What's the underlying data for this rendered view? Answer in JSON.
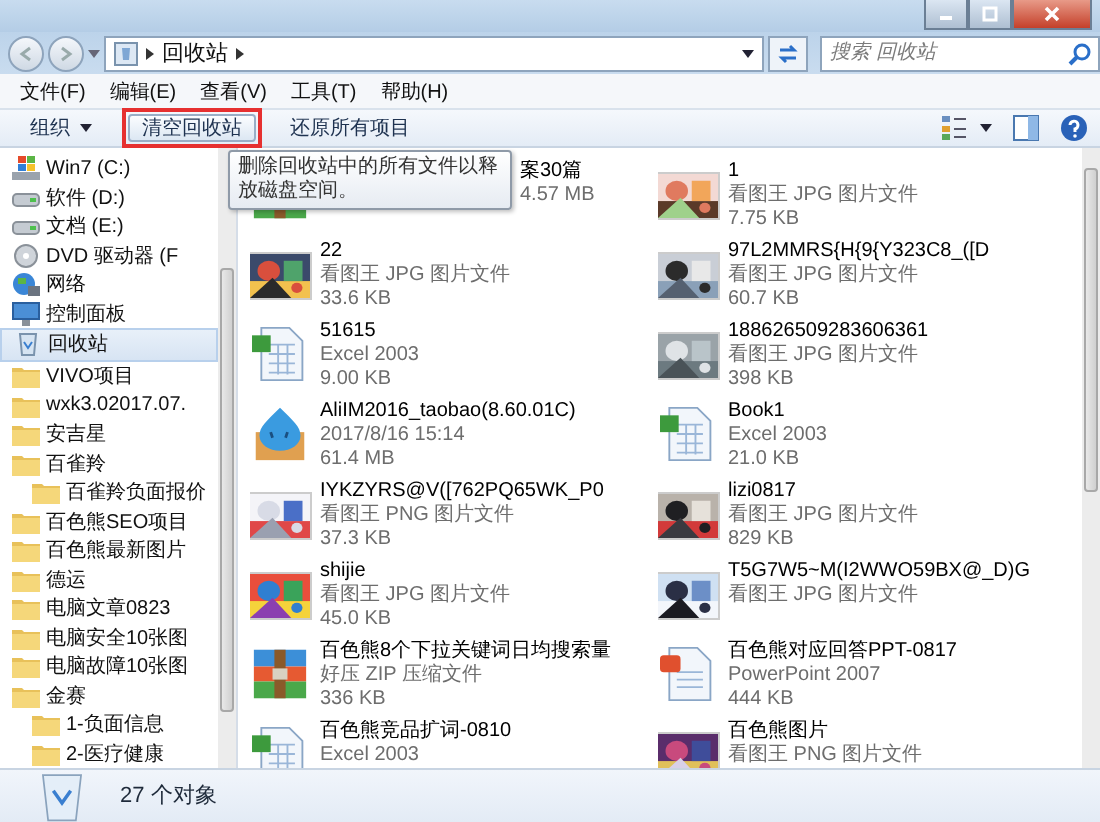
{
  "address": {
    "path": [
      "回收站"
    ]
  },
  "search": {
    "placeholder": "搜索 回收站"
  },
  "menu": [
    "文件(F)",
    "编辑(E)",
    "查看(V)",
    "工具(T)",
    "帮助(H)"
  ],
  "toolbar": {
    "organize": "组织",
    "buttons": [
      {
        "label": "清空回收站",
        "hovered": true,
        "annotated": true
      },
      {
        "label": "还原所有项目",
        "hovered": false,
        "annotated": false
      }
    ]
  },
  "tooltip": "删除回收站中的所有文件以释放磁盘空间。",
  "nav": [
    {
      "label": "Win7 (C:)",
      "kind": "system-drive",
      "selected": false
    },
    {
      "label": "软件 (D:)",
      "kind": "drive",
      "selected": false
    },
    {
      "label": "文档 (E:)",
      "kind": "drive",
      "selected": false
    },
    {
      "label": "DVD 驱动器 (F",
      "kind": "dvd",
      "selected": false
    },
    {
      "label": "网络",
      "kind": "network",
      "selected": false
    },
    {
      "label": "控制面板",
      "kind": "control-panel",
      "selected": false
    },
    {
      "label": "回收站",
      "kind": "recycle",
      "selected": true
    },
    {
      "label": "VIVO项目",
      "kind": "folder",
      "selected": false
    },
    {
      "label": "wxk3.02017.07.",
      "kind": "folder",
      "selected": false
    },
    {
      "label": "安吉星",
      "kind": "folder",
      "selected": false
    },
    {
      "label": "百雀羚",
      "kind": "folder",
      "selected": false,
      "children": [
        {
          "label": "百雀羚负面报价",
          "kind": "folder",
          "selected": false
        }
      ]
    },
    {
      "label": "百色熊SEO项目",
      "kind": "folder",
      "selected": false
    },
    {
      "label": "百色熊最新图片",
      "kind": "folder",
      "selected": false
    },
    {
      "label": "德运",
      "kind": "folder",
      "selected": false
    },
    {
      "label": "电脑文章0823",
      "kind": "folder",
      "selected": false
    },
    {
      "label": "电脑安全10张图",
      "kind": "folder",
      "selected": false
    },
    {
      "label": "电脑故障10张图",
      "kind": "folder",
      "selected": false
    },
    {
      "label": "金赛",
      "kind": "folder",
      "selected": false,
      "children": [
        {
          "label": "1-负面信息",
          "kind": "folder",
          "selected": false
        },
        {
          "label": "2-医疗健康",
          "kind": "folder",
          "selected": false
        }
      ]
    }
  ],
  "files": [
    {
      "kind": "zip",
      "name": "案30篇",
      "details": [
        "4.57 MB"
      ]
    },
    {
      "kind": "picture",
      "name": "1",
      "details": [
        "看图王 JPG 图片文件",
        "7.75 KB"
      ]
    },
    {
      "kind": "picture",
      "name": "22",
      "details": [
        "看图王 JPG 图片文件",
        "33.6 KB"
      ]
    },
    {
      "kind": "picture",
      "name": "97L2MMRS{H{9{Y323C8_([D",
      "details": [
        "看图王 JPG 图片文件",
        "60.7 KB"
      ]
    },
    {
      "kind": "excel",
      "name": "51615",
      "details": [
        "Excel 2003",
        "9.00 KB"
      ]
    },
    {
      "kind": "picture",
      "name": "188626509283606361",
      "details": [
        "看图王 JPG 图片文件",
        "398 KB"
      ]
    },
    {
      "kind": "app",
      "name": "AliIM2016_taobao(8.60.01C)",
      "details": [
        "2017/8/16 15:14",
        "61.4 MB"
      ]
    },
    {
      "kind": "excel",
      "name": "Book1",
      "details": [
        "Excel 2003",
        "21.0 KB"
      ]
    },
    {
      "kind": "picture",
      "name": "IYKZYRS@V([762PQ65WK_P0",
      "details": [
        "看图王 PNG 图片文件",
        "37.3 KB"
      ]
    },
    {
      "kind": "picture",
      "name": "lizi0817",
      "details": [
        "看图王 JPG 图片文件",
        "829 KB"
      ]
    },
    {
      "kind": "picture",
      "name": "shijie",
      "details": [
        "看图王 JPG 图片文件",
        "45.0 KB"
      ]
    },
    {
      "kind": "picture",
      "name": "T5G7W5~M(I2WWO59BX@_D)G",
      "details": [
        "看图王 JPG 图片文件"
      ]
    },
    {
      "kind": "zip",
      "name": "百色熊8个下拉关键词日均搜索量",
      "details": [
        "好压 ZIP 压缩文件",
        "336 KB"
      ]
    },
    {
      "kind": "ppt",
      "name": "百色熊对应回答PPT-0817",
      "details": [
        "PowerPoint 2007",
        "444 KB"
      ]
    },
    {
      "kind": "excel",
      "name": "百色熊竞品扩词-0810",
      "details": [
        "Excel 2003"
      ]
    },
    {
      "kind": "picture",
      "name": "百色熊图片",
      "details": [
        "看图王 PNG 图片文件"
      ]
    }
  ],
  "status": {
    "count": "27 个对象"
  }
}
